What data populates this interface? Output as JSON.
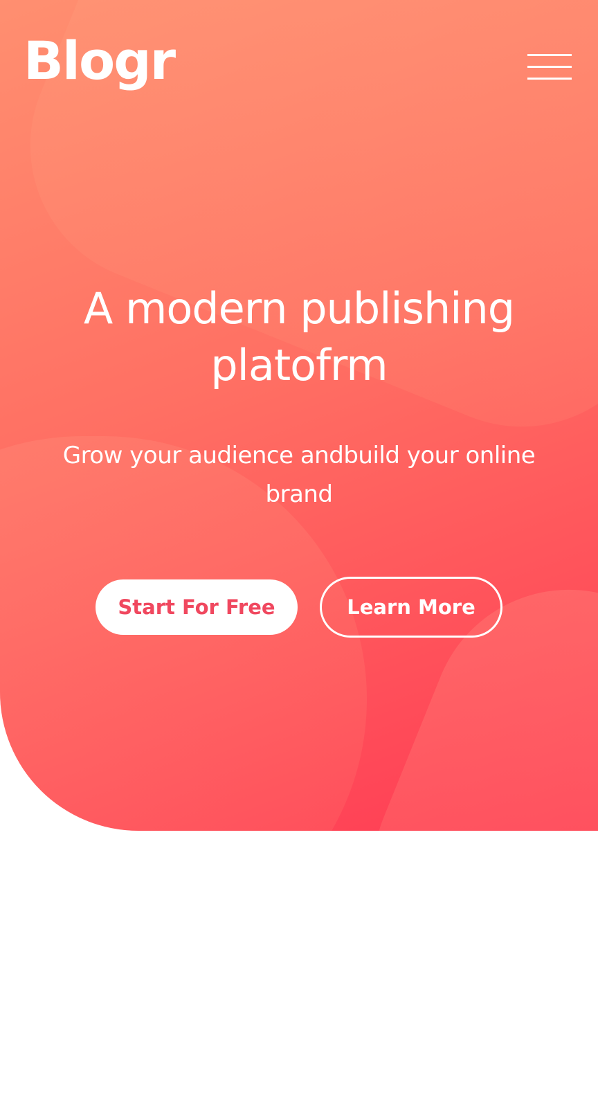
{
  "header": {
    "logo_text": "Blogr",
    "menu_icon": "hamburger-menu-icon"
  },
  "hero": {
    "title": "A modern publishing platofrm",
    "subtitle": "Grow your audience andbuild your online brand",
    "primary_button": "Start For Free",
    "secondary_button": "Learn More"
  },
  "colors": {
    "gradient_start": "#ff8f70",
    "gradient_end": "#ff3b54",
    "primary_button_text": "#f0485f",
    "text": "#ffffff",
    "page_background": "#ffffff"
  }
}
